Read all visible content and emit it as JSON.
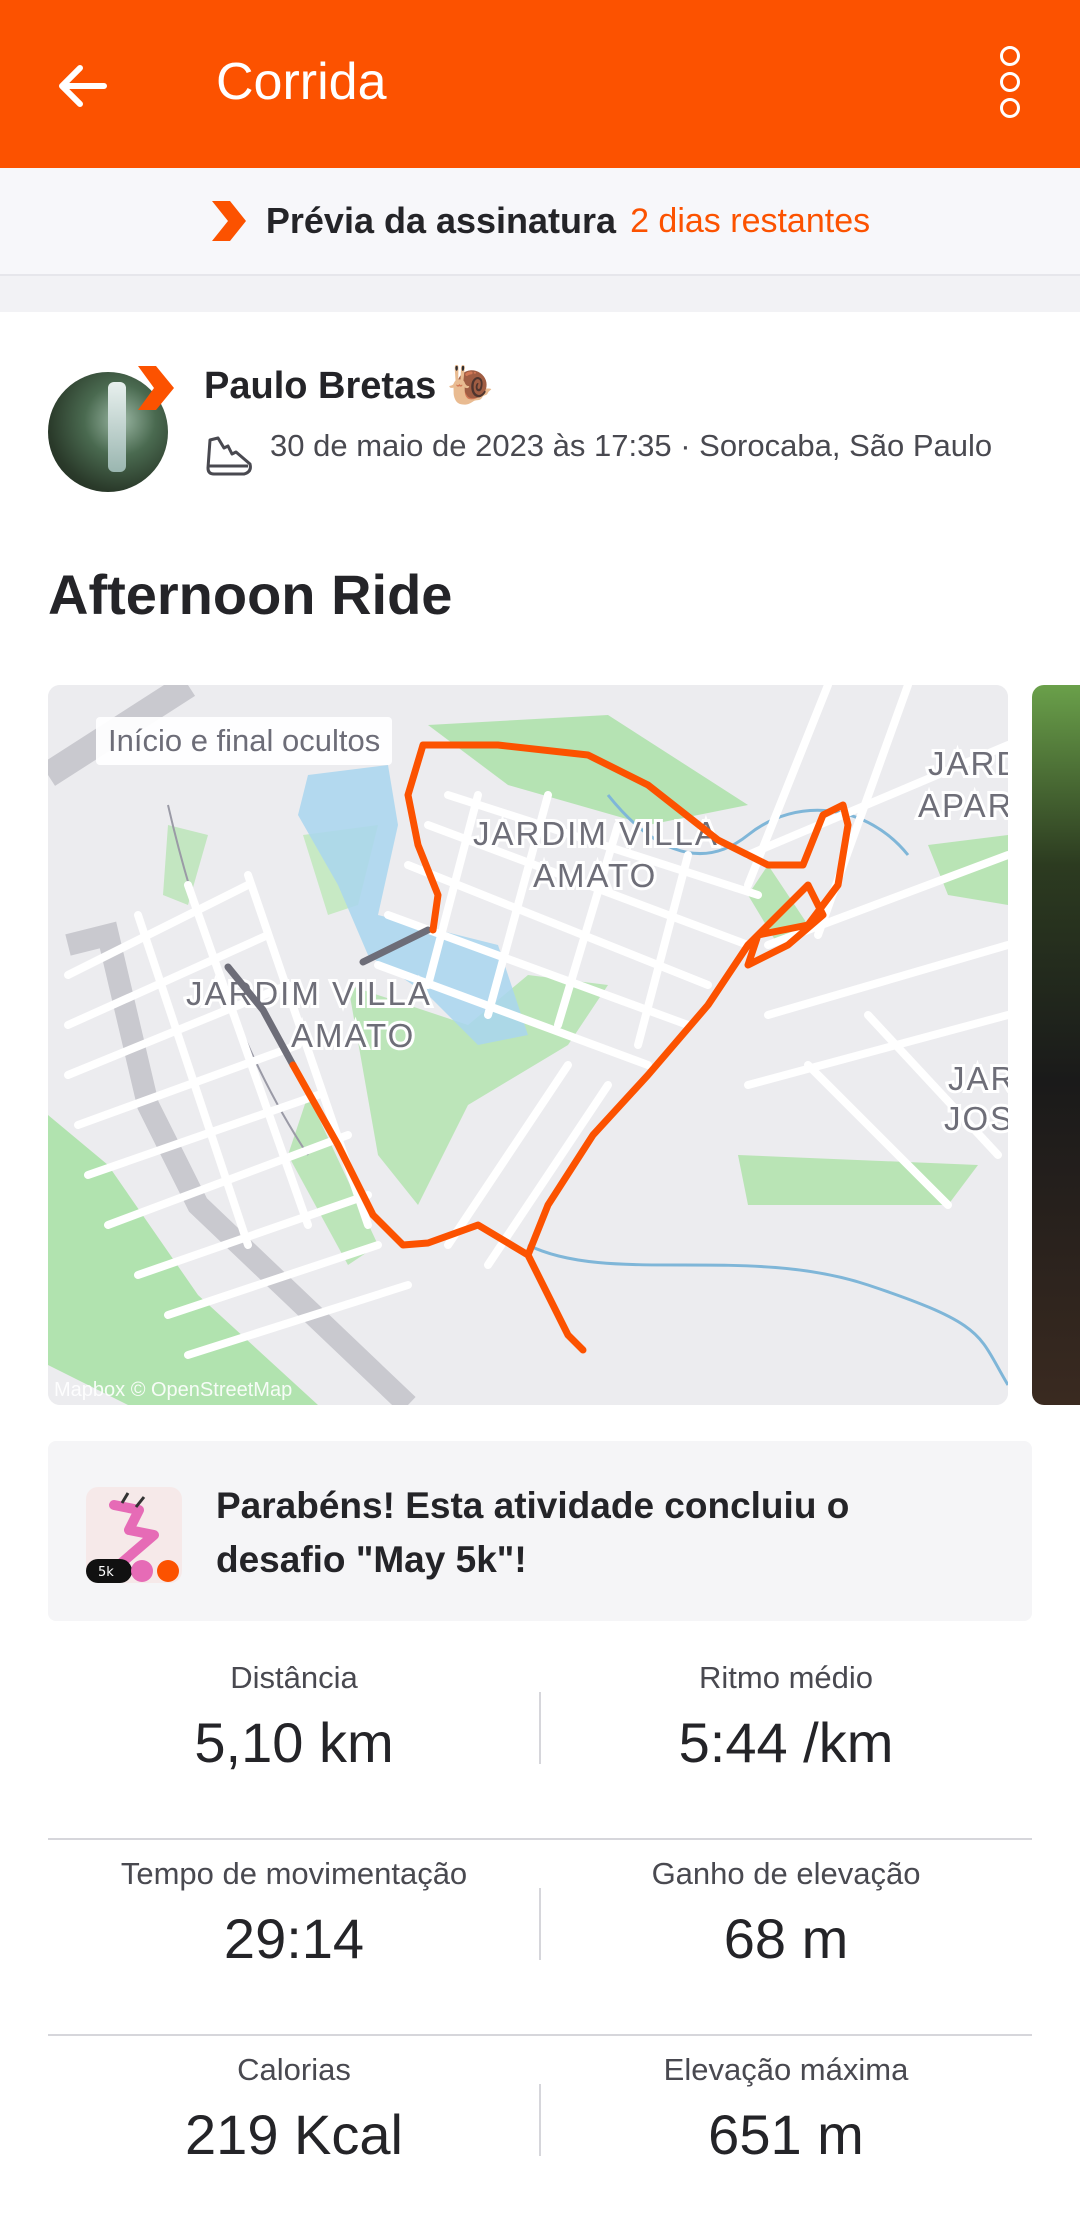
{
  "app_bar": {
    "title": "Corrida",
    "back_icon": "arrow-left-icon",
    "menu_icon": "more-vertical-icon"
  },
  "subscription_banner": {
    "label": "Prévia da assinatura",
    "days_left": "2 dias restantes",
    "accent": "#fc5200"
  },
  "athlete": {
    "name": "Paulo Bretas 🐌",
    "datetime_location": "30 de maio de 2023 às 17:35 · Sorocaba, São Paulo",
    "sport_icon": "shoe-icon"
  },
  "activity": {
    "title": "Afternoon Ride"
  },
  "map": {
    "privacy_tag": "Início e final ocultos",
    "attribution": "Mapbox © OpenStreetMap",
    "labels": [
      "JARDIM VILLA",
      "AMATO",
      "JARDIM VILLA",
      "AMATO",
      "JARD",
      "APAR",
      "JAR",
      "JOS"
    ],
    "route_color": "#fc5200"
  },
  "challenge": {
    "text": "Parabéns! Esta atividade concluiu o desafio \"May 5k\"!",
    "badge_label": "5k"
  },
  "stats": [
    {
      "left": {
        "label": "Distância",
        "value": "5,10 km"
      },
      "right": {
        "label": "Ritmo médio",
        "value": "5:44 /km"
      }
    },
    {
      "left": {
        "label": "Tempo de movimentação",
        "value": "29:14"
      },
      "right": {
        "label": "Ganho de elevação",
        "value": "68 m"
      }
    },
    {
      "left": {
        "label": "Calorias",
        "value": "219 Kcal"
      },
      "right": {
        "label": "Elevação máxima",
        "value": "651 m"
      }
    }
  ]
}
